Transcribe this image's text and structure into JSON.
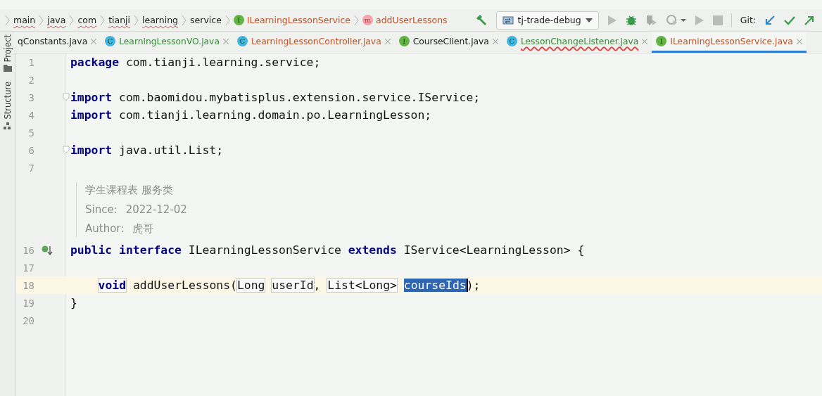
{
  "breadcrumbs": [
    {
      "label": "main",
      "kind": "folder",
      "misspelled": true
    },
    {
      "label": "java",
      "kind": "folder",
      "misspelled": true
    },
    {
      "label": "com",
      "kind": "folder",
      "misspelled": true
    },
    {
      "label": "tianji",
      "kind": "folder",
      "misspelled": true
    },
    {
      "label": "learning",
      "kind": "folder",
      "misspelled": true
    },
    {
      "label": "service",
      "kind": "folder",
      "misspelled": false
    },
    {
      "label": "ILearningLessonService",
      "kind": "interface",
      "badge": "I",
      "misspelled": false
    },
    {
      "label": "addUserLessons",
      "kind": "method",
      "badge": "m",
      "misspelled": false
    }
  ],
  "run_config": "tj-trade-debug",
  "git_label": "Git:",
  "side_tools": [
    "Project",
    "Structure"
  ],
  "tabs": [
    {
      "label": "qConstants.java",
      "color": "#222222",
      "selected": false,
      "misspelled": false
    },
    {
      "label": "LearningLessonVO.java",
      "kind": "class",
      "badge": "C",
      "color": "#3a8a3a",
      "selected": false,
      "misspelled": false
    },
    {
      "label": "LearningLessonController.java",
      "kind": "class",
      "badge": "C",
      "color": "#b9532a",
      "selected": false,
      "misspelled": false
    },
    {
      "label": "CourseClient.java",
      "kind": "interface",
      "badge": "I",
      "color": "#222222",
      "selected": false,
      "misspelled": false
    },
    {
      "label": "LessonChangeListener.java",
      "kind": "class",
      "badge": "C",
      "color": "#3a8a3a",
      "selected": false,
      "misspelled": true
    },
    {
      "label": "ILearningLessonService.java",
      "kind": "interface",
      "badge": "I",
      "color": "#b9532a",
      "selected": true,
      "misspelled": false
    }
  ],
  "code": [
    {
      "kind": "line",
      "number": "1",
      "tokens": [
        {
          "text": "package",
          "kind": "keyword"
        },
        {
          "text": " com.tianji.learning.service;",
          "kind": "plain"
        }
      ]
    },
    {
      "kind": "line",
      "number": "2"
    },
    {
      "kind": "line",
      "number": "3",
      "fold": true,
      "tokens": [
        {
          "text": "import",
          "kind": "keyword"
        },
        {
          "text": " com.baomidou.mybatisplus.extension.service.IService;",
          "kind": "plain"
        }
      ]
    },
    {
      "kind": "line",
      "number": "4",
      "tokens": [
        {
          "text": "import",
          "kind": "keyword"
        },
        {
          "text": " com.tianji.learning.domain.po.LearningLesson;",
          "kind": "plain"
        }
      ]
    },
    {
      "kind": "line",
      "number": "5"
    },
    {
      "kind": "line",
      "number": "6",
      "fold": true,
      "tokens": [
        {
          "text": "import",
          "kind": "keyword"
        },
        {
          "text": " java.util.List;",
          "kind": "plain"
        }
      ]
    },
    {
      "kind": "line",
      "number": "7"
    },
    {
      "kind": "doc",
      "description": "学生课程表 服务类",
      "tags": [
        {
          "label": "Since:",
          "value": "2022-12-02"
        },
        {
          "label": "Author:",
          "value": "虎哥"
        }
      ]
    },
    {
      "kind": "line",
      "number": "16",
      "implemented": true,
      "tokens": [
        {
          "text": "public",
          "kind": "keyword",
          "gap_after": true
        },
        {
          "text": "interface",
          "kind": "keyword"
        },
        {
          "text": " ILearningLessonService ",
          "kind": "plain"
        },
        {
          "text": "extends",
          "kind": "keyword"
        },
        {
          "text": " IService<LearningLesson> {",
          "kind": "plain"
        }
      ],
      "children": [
        {
          "kind": "line",
          "number": "17"
        },
        {
          "kind": "line",
          "number": "18",
          "current": true,
          "tokens": [
            {
              "text": "void",
              "kind": "boxed_keyword"
            },
            {
              "text": " addUserLessons(",
              "kind": "plain"
            },
            {
              "text": "Long",
              "kind": "boxed",
              "gap_after": true
            },
            {
              "text": "userId",
              "kind": "boxed"
            },
            {
              "text": ", ",
              "kind": "plain"
            },
            {
              "text": "List<Long>",
              "kind": "boxed",
              "gap_after": true
            },
            {
              "text": "courseIds",
              "kind": "selected"
            },
            {
              "text": ");",
              "kind": "plain"
            }
          ]
        }
      ]
    },
    {
      "kind": "line",
      "number": "19",
      "tokens": [
        {
          "text": "}",
          "kind": "plain"
        }
      ]
    },
    {
      "kind": "line",
      "number": "20"
    }
  ]
}
